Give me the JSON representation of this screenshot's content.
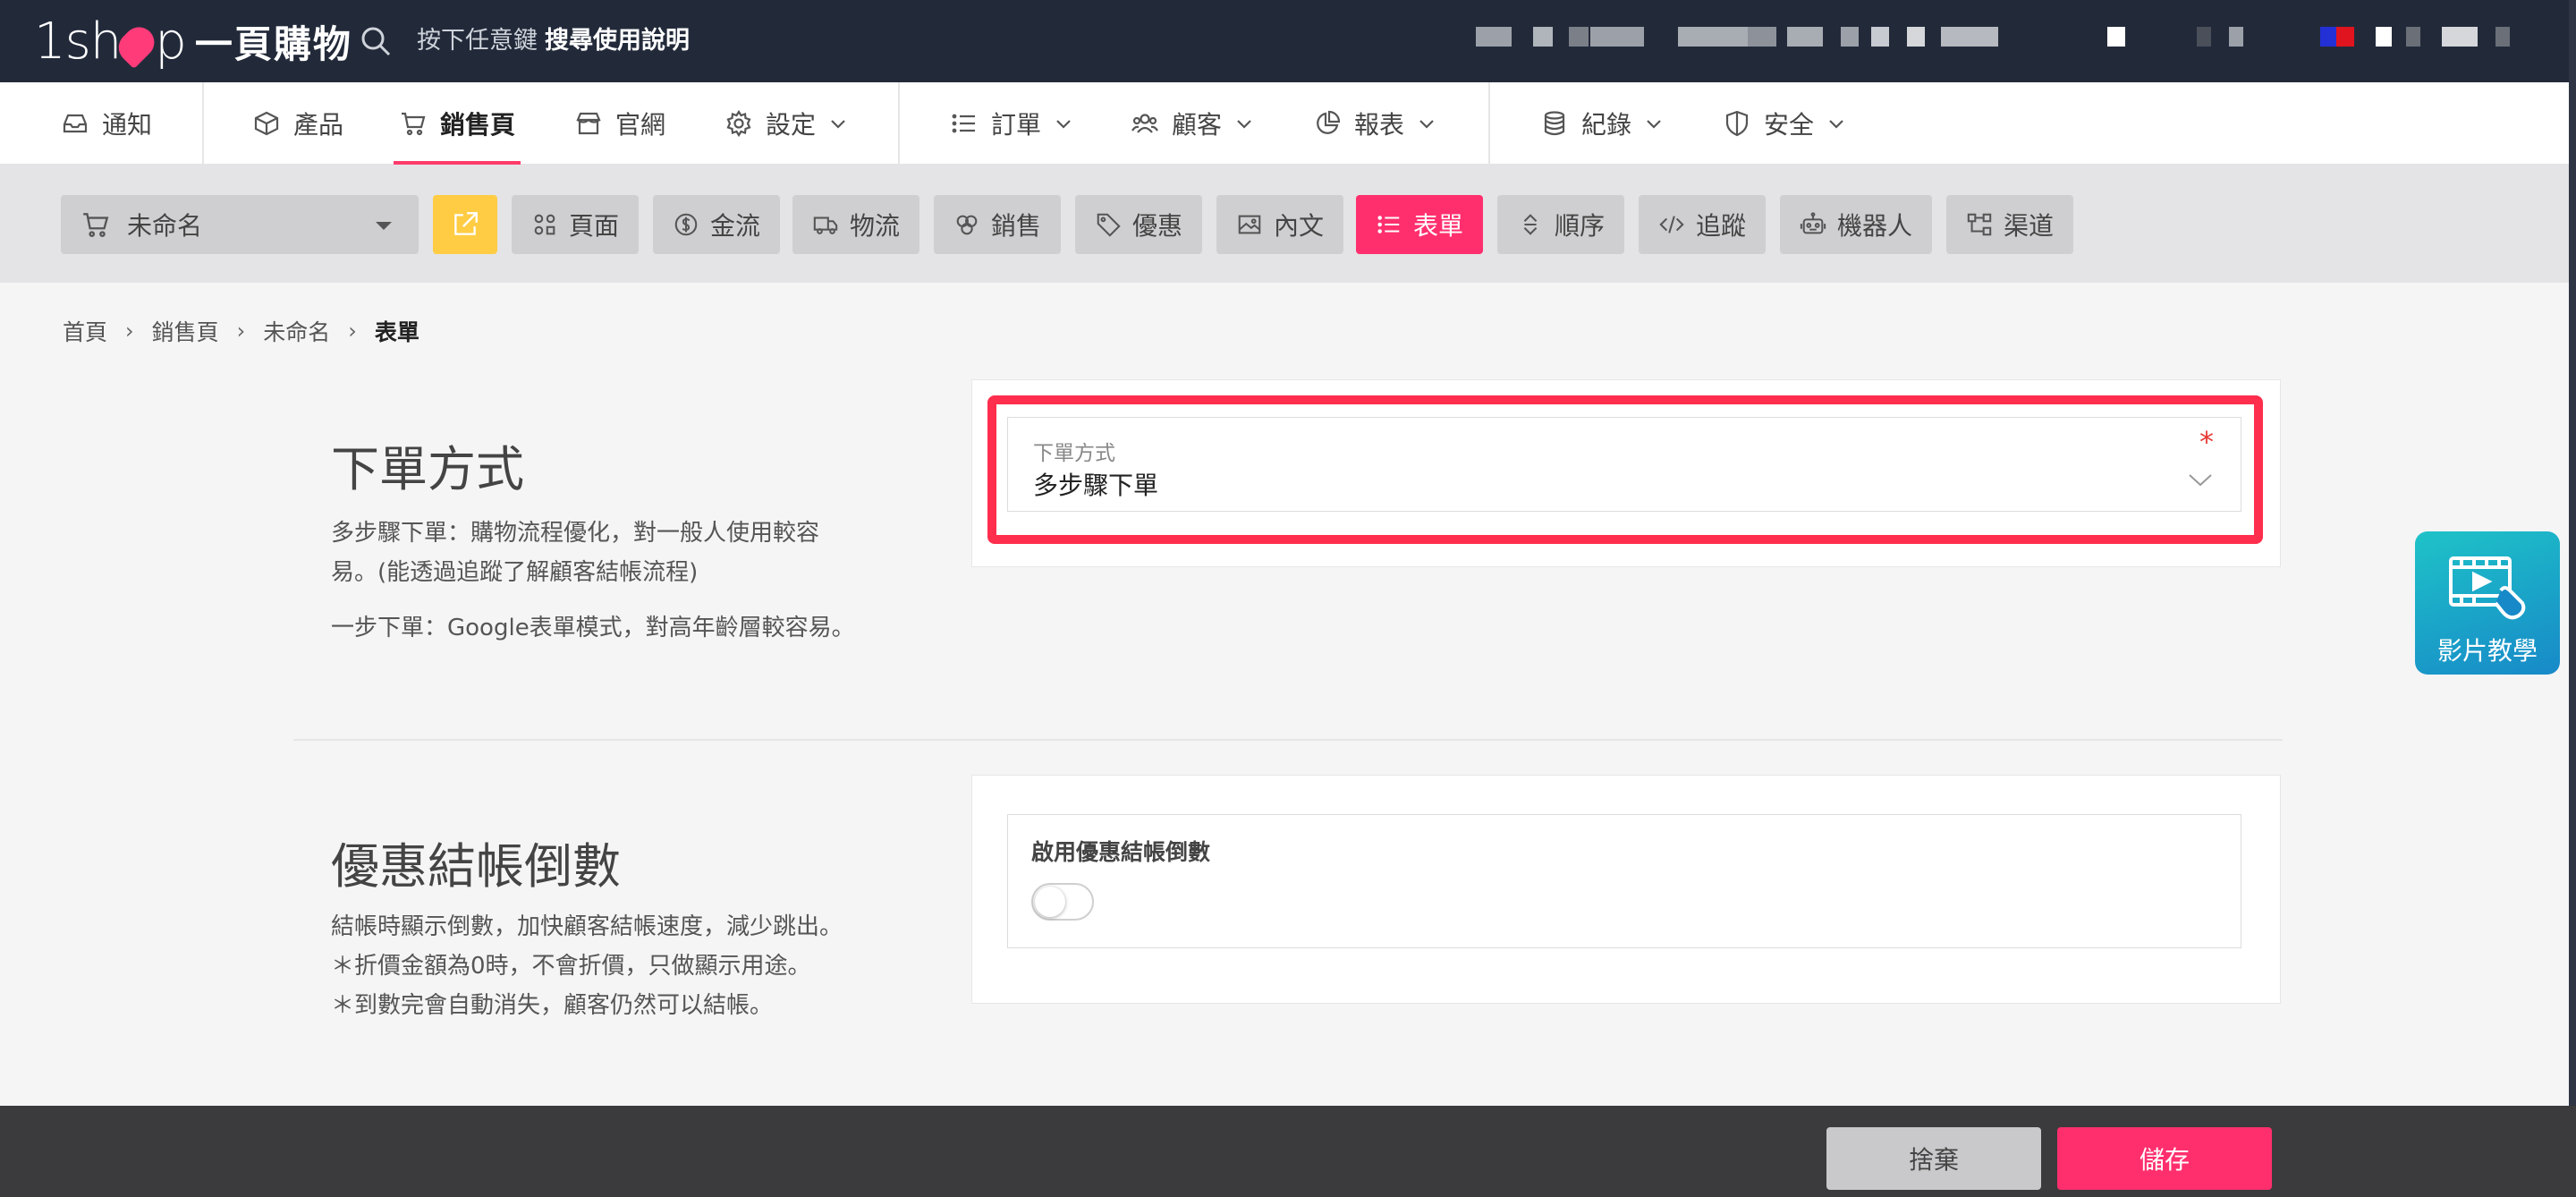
{
  "logo": {
    "brand_a": "1sh",
    "brand_b": "p",
    "brand_cn": "一頁購物"
  },
  "search": {
    "hint": "按下任意鍵",
    "link": "搜尋使用說明"
  },
  "mainnav": {
    "items": [
      {
        "label": "通知",
        "icon": "inbox-icon"
      },
      {
        "label": "產品",
        "icon": "box-icon"
      },
      {
        "label": "銷售頁",
        "icon": "cart-icon",
        "active": true
      },
      {
        "label": "官網",
        "icon": "store-icon"
      },
      {
        "label": "設定",
        "icon": "gear-icon",
        "dropdown": true
      },
      {
        "label": "訂單",
        "icon": "list-icon",
        "dropdown": true
      },
      {
        "label": "顧客",
        "icon": "users-icon",
        "dropdown": true
      },
      {
        "label": "報表",
        "icon": "pie-icon",
        "dropdown": true
      },
      {
        "label": "紀錄",
        "icon": "database-icon",
        "dropdown": true
      },
      {
        "label": "安全",
        "icon": "shield-icon",
        "dropdown": true
      }
    ]
  },
  "toolbar": {
    "page_select": "未命名",
    "buttons": [
      {
        "label": "頁面",
        "icon": "layout-icon"
      },
      {
        "label": "金流",
        "icon": "dollar-icon"
      },
      {
        "label": "物流",
        "icon": "truck-icon"
      },
      {
        "label": "銷售",
        "icon": "coins-icon"
      },
      {
        "label": "優惠",
        "icon": "tag-icon"
      },
      {
        "label": "內文",
        "icon": "image-icon"
      },
      {
        "label": "表單",
        "icon": "list-icon",
        "active": true
      },
      {
        "label": "順序",
        "icon": "sort-icon"
      },
      {
        "label": "追蹤",
        "icon": "code-icon"
      },
      {
        "label": "機器人",
        "icon": "robot-icon"
      },
      {
        "label": "渠道",
        "icon": "channel-icon"
      }
    ]
  },
  "breadcrumb": {
    "items": [
      "首頁",
      "銷售頁",
      "未命名"
    ],
    "current": "表單"
  },
  "order_method": {
    "title": "下單方式",
    "desc1": "多步驟下單：購物流程優化，對一般人使用較容",
    "desc2": "易。(能透過追蹤了解顧客結帳流程)",
    "desc3": "一步下單：Google表單模式，對高年齡層較容易。",
    "field_label": "下單方式",
    "field_value": "多步驟下單",
    "required_mark": "*"
  },
  "countdown": {
    "title": "優惠結帳倒數",
    "desc1": "結帳時顯示倒數，加快顧客結帳速度，減少跳出。",
    "desc2": "＊折價金額為0時，不會折價，只做顯示用途。",
    "desc3": "＊到數完會自動消失，顧客仍然可以結帳。",
    "toggle_label": "啟用優惠結帳倒數",
    "enabled": false
  },
  "video": {
    "label": "影片教學"
  },
  "footer": {
    "discard": "捨棄",
    "save": "儲存"
  },
  "colors": {
    "accent": "#ff2f6e",
    "topbar": "#222a3a",
    "highlight": "#ff2e4d",
    "yellow": "#ffcc44"
  }
}
